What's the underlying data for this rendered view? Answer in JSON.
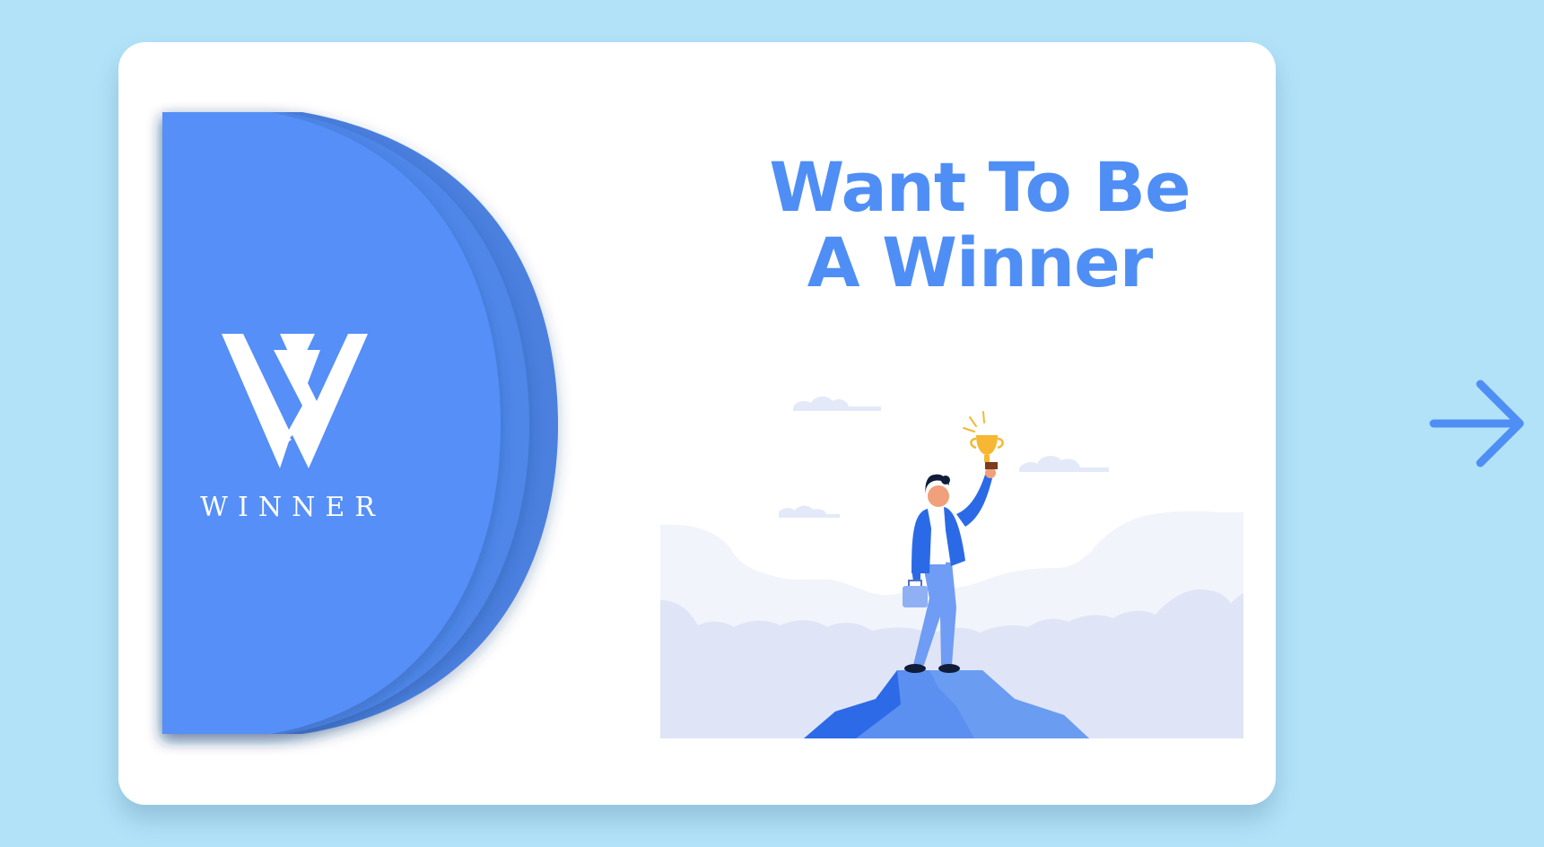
{
  "brand": {
    "wordmark": "WINNER",
    "icon": "winner-w-logo-icon",
    "color": "#548ff7"
  },
  "headline": {
    "line1": "Want To Be",
    "line2": "A Winner"
  },
  "illustration": {
    "icon": "person-holding-trophy-on-mountain-illustration"
  },
  "navigation": {
    "next_icon": "arrow-right-icon",
    "color": "#4f8ef5"
  },
  "colors": {
    "background": "#b1e2f8",
    "card": "#ffffff",
    "accent": "#4f8ef5"
  }
}
